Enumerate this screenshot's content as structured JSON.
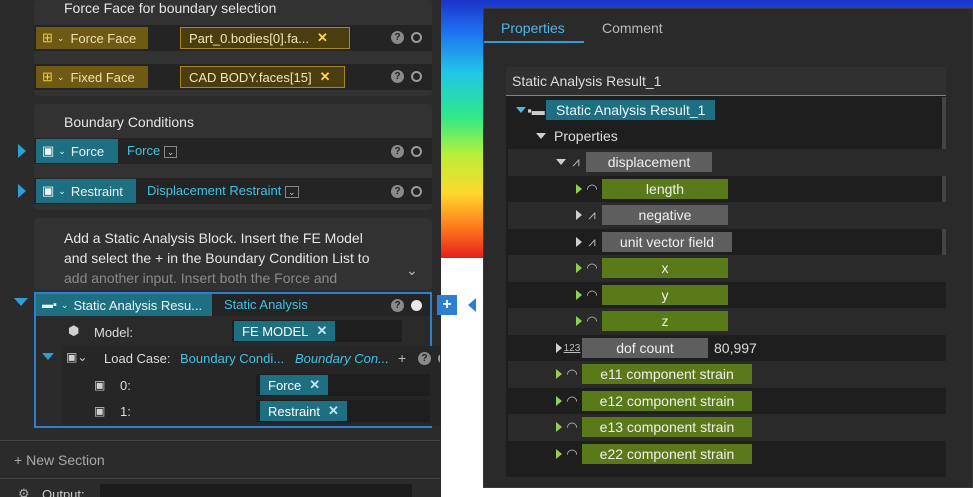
{
  "left": {
    "section1_text": "Force Face for boundary selection",
    "force_face": {
      "label": "Force Face",
      "value": "Part_0.bodies[0].fa..."
    },
    "fixed_face": {
      "label": "Fixed Face",
      "value": "CAD BODY.faces[15]"
    },
    "bc_title": "Boundary Conditions",
    "force_row": {
      "label": "Force",
      "value": "Force"
    },
    "restraint_row": {
      "label": "Restraint",
      "value": "Displacement Restraint"
    },
    "instructions": [
      "Add a Static Analysis Block. Insert the FE Model",
      "and select the + in the Boundary Condition List to",
      "add another input. Insert both the Force and"
    ],
    "static_block": {
      "label": "Static Analysis Resu...",
      "type": "Static Analysis",
      "model_label": "Model:",
      "model_value": "FE MODEL",
      "loadcase_label": "Load Case:",
      "loadcase_value": "Boundary Condi...",
      "loadcase_value2": "Boundary Con...",
      "items": [
        {
          "idx": "0:",
          "value": "Force"
        },
        {
          "idx": "1:",
          "value": "Restraint"
        }
      ]
    },
    "new_section": "New Section",
    "output_label": "Output:"
  },
  "props": {
    "tabs": [
      "Properties",
      "Comment"
    ],
    "header": "Static Analysis Result_1",
    "root": "Static Analysis Result_1",
    "properties_label": "Properties",
    "displacement": "displacement",
    "disp_children": [
      "length",
      "negative",
      "unit vector field",
      "x",
      "y",
      "z"
    ],
    "dof_label": "dof count",
    "dof_value": "80,997",
    "strains": [
      "e11 component strain",
      "e12 component strain",
      "e13 component strain",
      "e22 component strain"
    ]
  },
  "colors": {
    "teal": "#1f6f82",
    "gold": "#6e5a12",
    "green": "#5a7a1a",
    "accent": "#2f9ed6"
  }
}
